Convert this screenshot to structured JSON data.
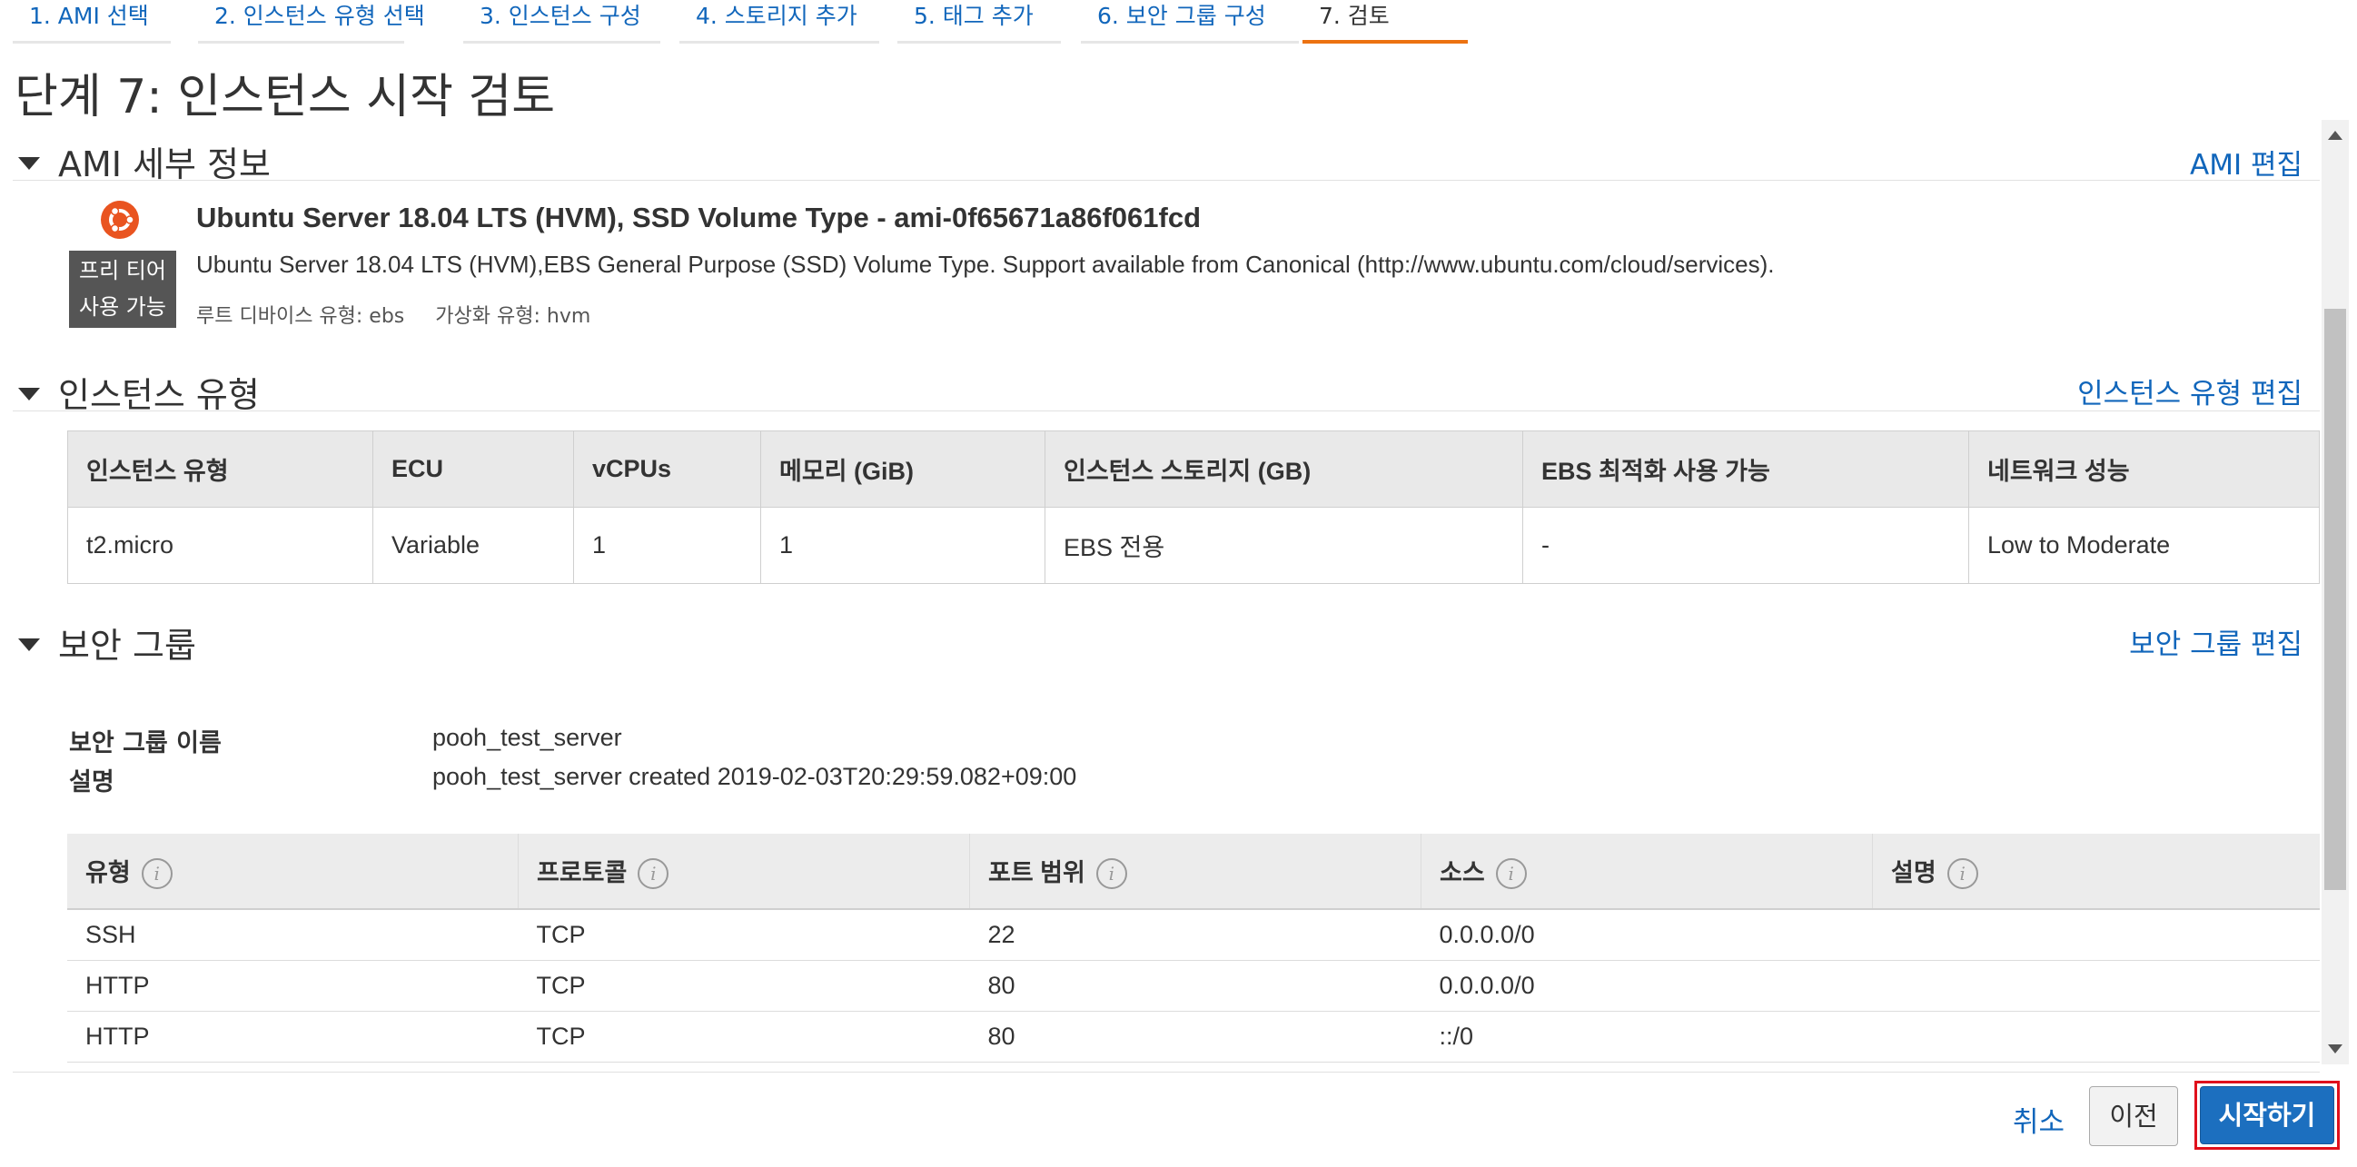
{
  "wizard_tabs": [
    {
      "label": "1. AMI 선택"
    },
    {
      "label": "2. 인스턴스 유형 선택"
    },
    {
      "label": "3. 인스턴스 구성"
    },
    {
      "label": "4. 스토리지 추가"
    },
    {
      "label": "5. 태그 추가"
    },
    {
      "label": "6. 보안 그룹 구성"
    },
    {
      "label": "7. 검토"
    }
  ],
  "active_tab_index": 6,
  "page_title": "단계 7: 인스턴스 시작 검토",
  "ami": {
    "section_title": "AMI 세부 정보",
    "edit_label": "AMI 편집",
    "name": "Ubuntu Server 18.04 LTS (HVM), SSD Volume Type - ami-0f65671a86f061fcd",
    "description": "Ubuntu Server 18.04 LTS (HVM),EBS General Purpose (SSD) Volume Type. Support available from Canonical (http://www.ubuntu.com/cloud/services).",
    "badge_line1": "프리 티어",
    "badge_line2": "사용 가능",
    "root_device": "루트 디바이스 유형: ebs",
    "virtualization": "가상화 유형: hvm",
    "logo_icon": "ubuntu-logo-icon"
  },
  "instance_type": {
    "section_title": "인스턴스 유형",
    "edit_label": "인스턴스 유형 편집",
    "headers": [
      "인스턴스 유형",
      "ECU",
      "vCPUs",
      "메모리 (GiB)",
      "인스턴스 스토리지 (GB)",
      "EBS 최적화 사용 가능",
      "네트워크 성능"
    ],
    "row": [
      "t2.micro",
      "Variable",
      "1",
      "1",
      "EBS 전용",
      "-",
      "Low to Moderate"
    ]
  },
  "security_group": {
    "section_title": "보안 그룹",
    "edit_label": "보안 그룹 편집",
    "name_label": "보안 그룹 이름",
    "name_value": "pooh_test_server",
    "desc_label": "설명",
    "desc_value": "pooh_test_server created 2019-02-03T20:29:59.082+09:00",
    "rule_headers": [
      "유형",
      "프로토콜",
      "포트 범위",
      "소스",
      "설명"
    ],
    "info_glyph": "i",
    "rules": [
      [
        "SSH",
        "TCP",
        "22",
        "0.0.0.0/0",
        ""
      ],
      [
        "HTTP",
        "TCP",
        "80",
        "0.0.0.0/0",
        ""
      ],
      [
        "HTTP",
        "TCP",
        "80",
        "::/0",
        ""
      ]
    ]
  },
  "footer": {
    "cancel_label": "취소",
    "previous_label": "이전",
    "launch_label": "시작하기"
  },
  "colors": {
    "link": "#1166bb",
    "active_tab_underline": "#ec7211",
    "launch_button": "#1c6fbf",
    "highlight_frame": "#e0101c",
    "ubuntu_orange": "#e95420"
  }
}
